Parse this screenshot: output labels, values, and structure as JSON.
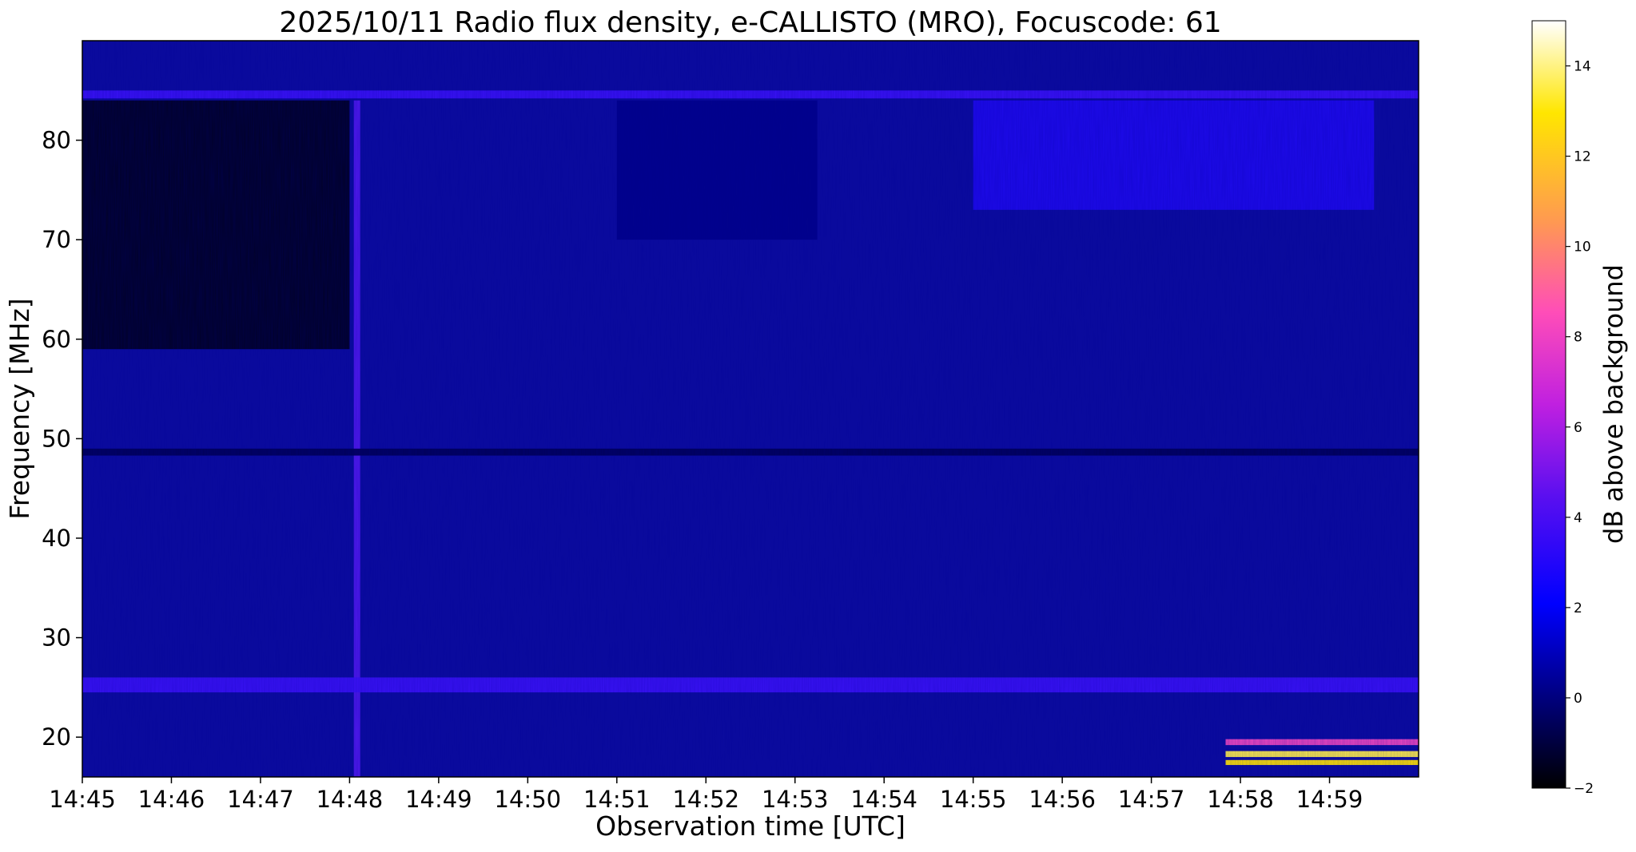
{
  "chart_data": {
    "type": "heatmap",
    "title": "2025/10/11  Radio flux density, e-CALLISTO (MRO), Focuscode: 61",
    "xlabel": "Observation time [UTC]",
    "ylabel": "Frequency [MHz]",
    "x_ticks": [
      "14:45",
      "14:46",
      "14:47",
      "14:48",
      "14:49",
      "14:50",
      "14:51",
      "14:52",
      "14:53",
      "14:54",
      "14:55",
      "14:56",
      "14:57",
      "14:58",
      "14:59"
    ],
    "xlim": [
      "14:45",
      "15:00"
    ],
    "y_ticks": [
      20,
      30,
      40,
      50,
      60,
      70,
      80
    ],
    "ylim": [
      16,
      90
    ],
    "colorbar": {
      "label": "dB above background",
      "ticks": [
        -2,
        0,
        2,
        4,
        6,
        8,
        10,
        12,
        14
      ],
      "range": [
        -2,
        15
      ],
      "colormap": "gnuplot2",
      "stops": [
        "#000000",
        "#0000ff",
        "#8a2be2",
        "#ff4db8",
        "#ff9a50",
        "#ffe600",
        "#ffffff"
      ]
    },
    "background_level_db": 0.3,
    "features": [
      {
        "kind": "vertical_line",
        "time": "14:48:05",
        "freq_range": [
          16,
          84
        ],
        "value_db": 2.5
      },
      {
        "kind": "dark_region",
        "time_range": [
          "14:45",
          "14:48"
        ],
        "freq_range": [
          59,
          84
        ],
        "value_db": -1.8
      },
      {
        "kind": "dark_region",
        "time_range": [
          "14:51",
          "14:53:15"
        ],
        "freq_range": [
          70,
          84
        ],
        "value_db": -0.5
      },
      {
        "kind": "bright_region",
        "time_range": [
          "14:55",
          "14:59:30"
        ],
        "freq_range": [
          73,
          84
        ],
        "value_db": 1.5
      },
      {
        "kind": "horizontal_band",
        "freq_range": [
          24.5,
          26
        ],
        "time_range": [
          "14:45",
          "15:00"
        ],
        "value_db": 2.0
      },
      {
        "kind": "horizontal_band",
        "freq_range": [
          48.3,
          49.0
        ],
        "time_range": [
          "14:45",
          "15:00"
        ],
        "value_db": -1.0
      },
      {
        "kind": "horizontal_band",
        "freq_range": [
          84.2,
          85.0
        ],
        "time_range": [
          "14:45",
          "15:00"
        ],
        "value_db": 2.0
      },
      {
        "kind": "horizontal_band",
        "freq_range": [
          18.0,
          18.6
        ],
        "time_range": [
          "14:57:50",
          "15:00"
        ],
        "value_db": 13
      },
      {
        "kind": "horizontal_band",
        "freq_range": [
          17.2,
          17.7
        ],
        "time_range": [
          "14:57:50",
          "15:00"
        ],
        "value_db": 12
      },
      {
        "kind": "horizontal_band",
        "freq_range": [
          19.2,
          19.8
        ],
        "time_range": [
          "14:57:50",
          "15:00"
        ],
        "value_db": 6
      }
    ]
  }
}
